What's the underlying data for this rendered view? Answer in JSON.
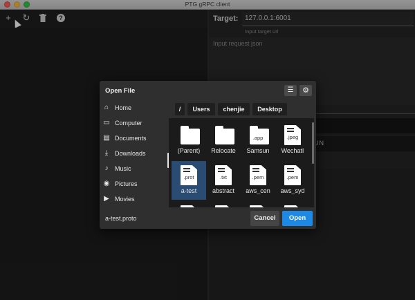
{
  "window": {
    "title": "PTG gRPC client"
  },
  "toolbar": {
    "add_icon": "+",
    "reload_icon": "↻",
    "delete_icon": "trash",
    "help_icon": "?"
  },
  "target": {
    "label": "Target:",
    "value": "127.0.0.1:6001",
    "helper": "Input target url"
  },
  "request": {
    "placeholder": "Input request json"
  },
  "run": {
    "label": "UN"
  },
  "dialog": {
    "title": "Open File",
    "sidebar": [
      {
        "label": "Home",
        "icon": "home-icon"
      },
      {
        "label": "Computer",
        "icon": "laptop-icon"
      },
      {
        "label": "Documents",
        "icon": "document-icon"
      },
      {
        "label": "Downloads",
        "icon": "download-icon"
      },
      {
        "label": "Music",
        "icon": "music-icon"
      },
      {
        "label": "Pictures",
        "icon": "camera-icon"
      },
      {
        "label": "Movies",
        "icon": "movie-icon"
      }
    ],
    "breadcrumb": [
      "/",
      "Users",
      "chenjie",
      "Desktop"
    ],
    "files": [
      {
        "label": "(Parent)",
        "type": "folder"
      },
      {
        "label": "Relocate",
        "type": "folder"
      },
      {
        "label": "Samsun",
        "type": "folder-app",
        "ext": ".app"
      },
      {
        "label": "WechatI",
        "type": "doc",
        "ext": ".jpeg"
      },
      {
        "label": "a-test",
        "type": "doc",
        "ext": ".prot",
        "selected": true
      },
      {
        "label": "abstract",
        "type": "doc",
        "ext": ".txt"
      },
      {
        "label": "aws_cen",
        "type": "doc",
        "ext": ".pem"
      },
      {
        "label": "aws_syd",
        "type": "doc",
        "ext": ".pem"
      }
    ],
    "filename": "a-test.proto",
    "cancel": "Cancel",
    "open": "Open"
  },
  "colors": {
    "accent": "#1e88e5",
    "selection": "#2b4c72"
  }
}
